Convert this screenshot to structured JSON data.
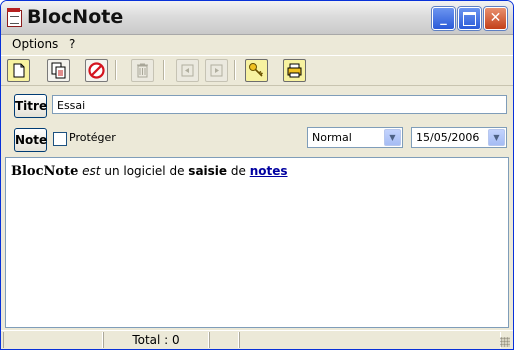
{
  "window": {
    "title": "BlocNote"
  },
  "menu": {
    "items": [
      "Options",
      "?"
    ]
  },
  "toolbar": {
    "buttons": [
      {
        "name": "new-document-icon"
      },
      {
        "name": "save-document-icon"
      },
      {
        "name": "cancel-icon"
      },
      {
        "name": "delete-trash-icon",
        "disabled": true
      },
      {
        "name": "previous-icon",
        "disabled": true
      },
      {
        "name": "next-icon",
        "disabled": true
      },
      {
        "name": "key-icon"
      },
      {
        "name": "print-icon"
      }
    ]
  },
  "form": {
    "titre_button": "Titre",
    "titre_value": "Essai",
    "note_button": "Note",
    "proteger_label": "Protéger",
    "style_select": "Normal",
    "date_select": "15/05/2006"
  },
  "editor": {
    "word1": "BlocNote",
    "word2": "est",
    "word3": "un logiciel de",
    "word4": "saisie",
    "word5": "de",
    "word6": "notes"
  },
  "status": {
    "total": "Total : 0"
  },
  "colors": {
    "title_bar": "#dcdcdc",
    "accent": "#0831d9",
    "link": "#0000a0",
    "cancel_red": "#d4141e"
  }
}
